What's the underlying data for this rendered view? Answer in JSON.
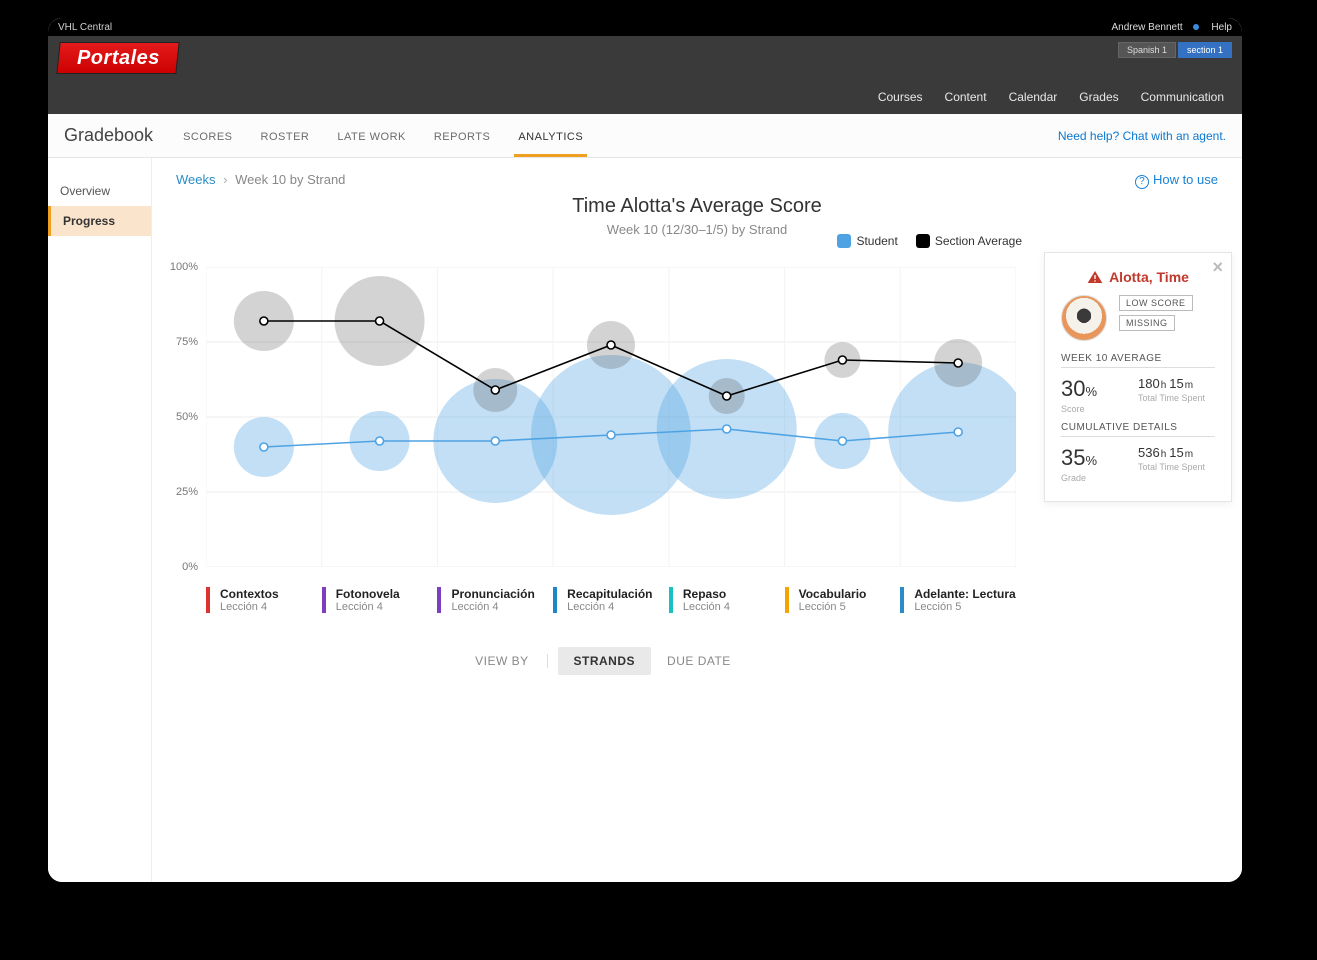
{
  "colors": {
    "accent_orange": "#f0a020",
    "link_blue": "#1a82d6",
    "student_blue": "#4fa3e3",
    "section_black": "#000000",
    "danger": "#c0392b"
  },
  "topbar": {
    "brand": "VHL Central",
    "user": "Andrew Bennett",
    "help": "Help"
  },
  "header": {
    "logo_text": "Portales",
    "course_chip": "Spanish 1",
    "section_chip": "section 1",
    "nav": [
      "Courses",
      "Content",
      "Calendar",
      "Grades",
      "Communication"
    ]
  },
  "subheader": {
    "title": "Gradebook",
    "tabs": [
      "SCORES",
      "ROSTER",
      "LATE WORK",
      "REPORTS",
      "ANALYTICS"
    ],
    "active_tab": 4,
    "help_link": "Need help? Chat with an agent."
  },
  "sidebar": {
    "items": [
      "Overview",
      "Progress"
    ],
    "active": 1
  },
  "breadcrumb": {
    "root": "Weeks",
    "current": "Week 10 by Strand"
  },
  "howto": "How to use",
  "chart": {
    "title": "Time Alotta's Average Score",
    "subtitle": "Week 10 (12/30–1/5) by Strand"
  },
  "legend": {
    "student": "Student",
    "section": "Section Average"
  },
  "chart_data": {
    "type": "line",
    "ylabel": "",
    "ylim": [
      0,
      100
    ],
    "yticks": [
      "0%",
      "25%",
      "50%",
      "75%",
      "100%"
    ],
    "categories": [
      "Contextos",
      "Fotonovela",
      "Pronunciación",
      "Recapitulación",
      "Repaso",
      "Vocabulario",
      "Adelante: Lectura"
    ],
    "category_subs": [
      "Lección 4",
      "Lección 4",
      "Lección 4",
      "Lección 4",
      "Lección 4",
      "Lección 5",
      "Lección 5"
    ],
    "category_colors": [
      "#e03131",
      "#7b3fbf",
      "#7b3fbf",
      "#1e88c7",
      "#16c1c1",
      "#f4a300",
      "#2a8cc9"
    ],
    "series": [
      {
        "name": "Student",
        "color": "#4fa3e3",
        "values": [
          40,
          42,
          42,
          44,
          46,
          42,
          45
        ],
        "sizes": [
          30,
          30,
          62,
          80,
          70,
          28,
          70
        ]
      },
      {
        "name": "Section Average",
        "color": "#000000",
        "values": [
          82,
          82,
          59,
          74,
          57,
          69,
          68
        ],
        "sizes": [
          30,
          45,
          22,
          24,
          18,
          18,
          24
        ]
      }
    ]
  },
  "viewby": {
    "label": "VIEW BY",
    "options": [
      "STRANDS",
      "DUE DATE"
    ],
    "active": 0
  },
  "panel": {
    "student_name": "Alotta, Time",
    "badges": [
      "LOW SCORE",
      "MISSING"
    ],
    "week_title": "WEEK 10 AVERAGE",
    "week_score": "30",
    "week_score_unit": "%",
    "week_score_label": "Score",
    "week_time_h": "180",
    "week_time_m": "15",
    "time_label": "Total Time Spent",
    "cum_title": "CUMULATIVE DETAILS",
    "cum_grade": "35",
    "cum_grade_unit": "%",
    "cum_grade_label": "Grade",
    "cum_time_h": "536",
    "cum_time_m": "15"
  }
}
